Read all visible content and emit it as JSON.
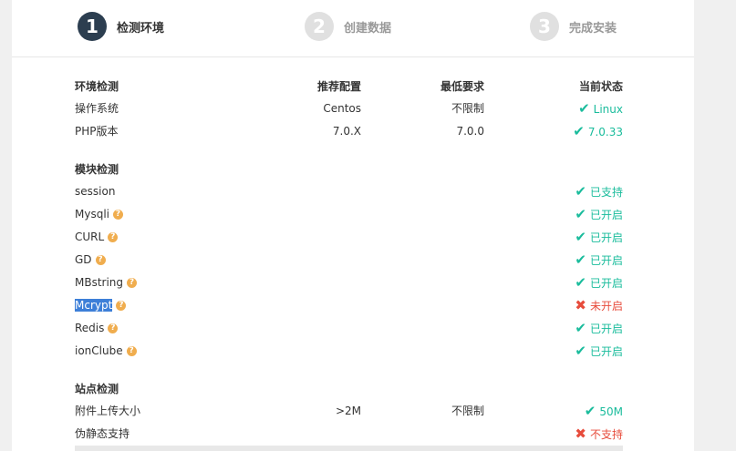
{
  "steps": [
    {
      "num": "1",
      "label": "检测环境"
    },
    {
      "num": "2",
      "label": "创建数据"
    },
    {
      "num": "3",
      "label": "完成安装"
    }
  ],
  "env": {
    "header": {
      "name": "环境检测",
      "rec": "推荐配置",
      "min": "最低要求",
      "status": "当前状态"
    },
    "rows": [
      {
        "name": "操作系统",
        "rec": "Centos",
        "min": "不限制",
        "status": "Linux"
      },
      {
        "name": "PHP版本",
        "rec": "7.0.X",
        "min": "7.0.0",
        "status": "7.0.33"
      }
    ]
  },
  "modules": {
    "header": "模块检测",
    "help_glyph": "?",
    "rows": [
      {
        "name": "session",
        "status": "已支持"
      },
      {
        "name": "Mysqli",
        "status": "已开启"
      },
      {
        "name": "CURL",
        "status": "已开启"
      },
      {
        "name": "GD",
        "status": "已开启"
      },
      {
        "name": "MBstring",
        "status": "已开启"
      },
      {
        "name": "Mcrypt",
        "status": "未开启"
      },
      {
        "name": "Redis",
        "status": "已开启"
      },
      {
        "name": "ionClube",
        "status": "已开启"
      }
    ]
  },
  "site": {
    "header": "站点检测",
    "rows": [
      {
        "name": "附件上传大小",
        "rec": ">2M",
        "min": "不限制",
        "status": "50M"
      },
      {
        "name": "伪静态支持",
        "status": "不支持"
      }
    ]
  },
  "glyphs": {
    "ok": "✔",
    "fail": "✖"
  },
  "colors": {
    "ok": "#1abc9c",
    "fail": "#e74c3c",
    "help": "#f0ad4e",
    "active_step": "#2c3e50"
  }
}
